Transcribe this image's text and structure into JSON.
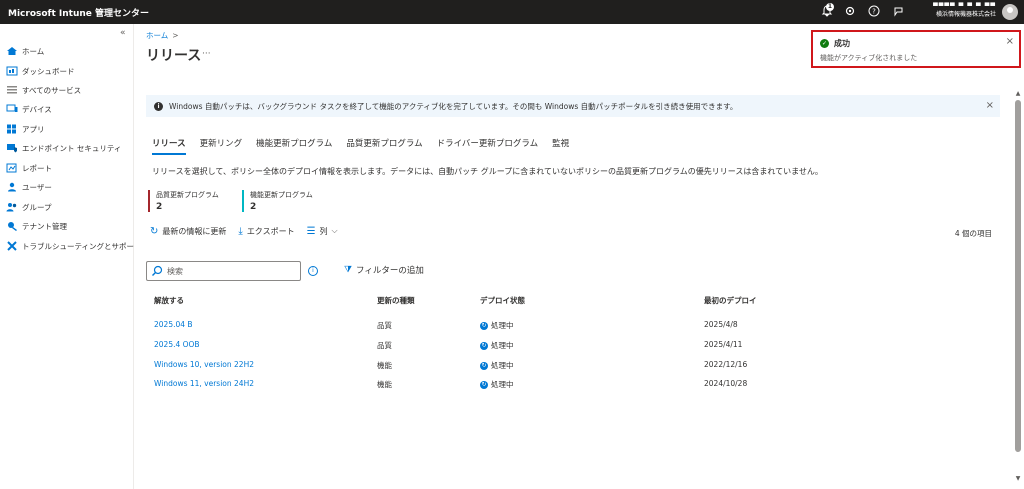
{
  "topbar": {
    "title": "Microsoft Intune 管理センター",
    "notification_count": "1",
    "user_name": "▀▀▀▀ ▀ ▀ ▀ ▀▀",
    "user_org": "横浜情報機器株式会社"
  },
  "sidebar": {
    "collapse": "«",
    "items": [
      {
        "label": "ホーム",
        "icon": "home-icon"
      },
      {
        "label": "ダッシュボード",
        "icon": "dashboard-icon"
      },
      {
        "label": "すべてのサービス",
        "icon": "list-icon"
      },
      {
        "label": "デバイス",
        "icon": "devices-icon"
      },
      {
        "label": "アプリ",
        "icon": "apps-icon"
      },
      {
        "label": "エンドポイント セキュリティ",
        "icon": "endpoint-security-icon"
      },
      {
        "label": "レポート",
        "icon": "reports-icon"
      },
      {
        "label": "ユーザー",
        "icon": "users-icon"
      },
      {
        "label": "グループ",
        "icon": "groups-icon"
      },
      {
        "label": "テナント管理",
        "icon": "tenant-icon"
      },
      {
        "label": "トラブルシューティングとサポート",
        "icon": "troubleshoot-icon"
      }
    ]
  },
  "breadcrumb": {
    "home": "ホーム",
    "sep": ">"
  },
  "page": {
    "title": "リリース",
    "more": "···"
  },
  "info_bar": {
    "text": "Windows 自動パッチは、バックグラウンド タスクを終了して機能のアクティブ化を完了しています。その間も Windows 自動パッチポータルを引き続き使用できます。",
    "close": "×"
  },
  "tabs": [
    "リリース",
    "更新リング",
    "機能更新プログラム",
    "品質更新プログラム",
    "ドライバー更新プログラム",
    "監視"
  ],
  "description": "リリースを選択して、ポリシー全体のデプロイ情報を表示します。データには、自動パッチ グループに含まれていないポリシーの品質更新プログラムの優先リリースは含まれていません。",
  "stats": [
    {
      "label": "品質更新プログラム",
      "value": "2",
      "color": "#a4262c"
    },
    {
      "label": "機能更新プログラム",
      "value": "2",
      "color": "#00b7c3"
    }
  ],
  "toolbar": {
    "refresh": "最新の情報に更新",
    "export": "エクスポート",
    "columns": "列",
    "count": "4 個の項目"
  },
  "search": {
    "placeholder": "検索"
  },
  "filter": {
    "label": "フィルターの追加"
  },
  "table": {
    "headers": [
      "解放する",
      "更新の種類",
      "デプロイ状態",
      "最初のデプロイ"
    ],
    "rows": [
      {
        "release": "2025.04 B",
        "type": "品質",
        "status": "処理中",
        "first": "2025/4/8"
      },
      {
        "release": "2025.4 OOB",
        "type": "品質",
        "status": "処理中",
        "first": "2025/4/11"
      },
      {
        "release": "Windows 10, version 22H2",
        "type": "機能",
        "status": "処理中",
        "first": "2022/12/16"
      },
      {
        "release": "Windows 11, version 24H2",
        "type": "機能",
        "status": "処理中",
        "first": "2024/10/28"
      }
    ]
  },
  "toast": {
    "title": "成功",
    "message": "機能がアクティブ化されました",
    "close": "×",
    "border_color": "#d0171b"
  }
}
